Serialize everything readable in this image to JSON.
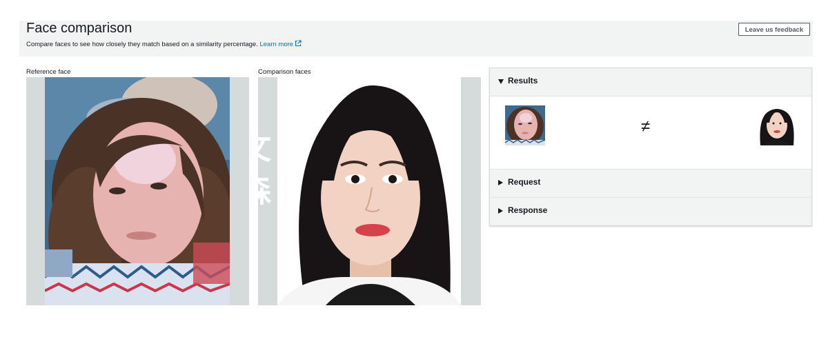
{
  "header": {
    "title": "Face comparison",
    "description": "Compare faces to see how closely they match based on a similarity percentage.",
    "learn_more": "Learn more",
    "feedback_label": "Leave us feedback"
  },
  "reference": {
    "label": "Reference face"
  },
  "comparison": {
    "label": "Comparison faces",
    "watermark": "文 森"
  },
  "results": {
    "sections": [
      {
        "label": "Results",
        "expanded": true
      },
      {
        "label": "Request",
        "expanded": false
      },
      {
        "label": "Response",
        "expanded": false
      }
    ],
    "match_symbol": "≠"
  },
  "colors": {
    "link": "#0073bb",
    "panel_bg": "#d5dbdb",
    "header_bg": "#f2f3f3"
  }
}
